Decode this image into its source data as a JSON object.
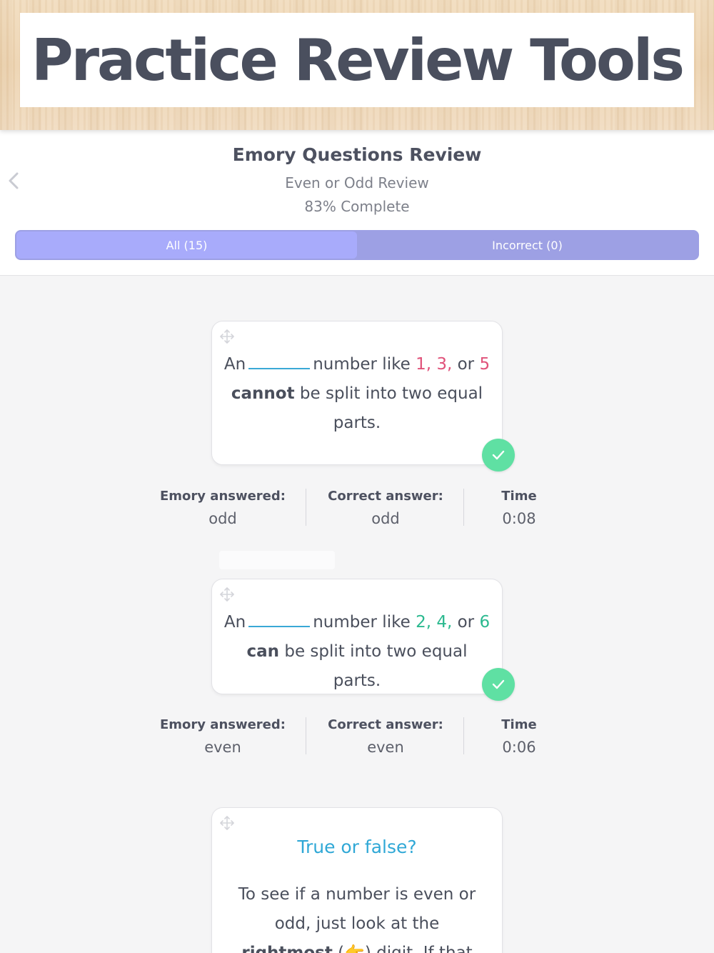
{
  "banner": {
    "title": "Practice Review Tools"
  },
  "header": {
    "title": "Emory Questions Review",
    "subtitle": "Even or Odd Review",
    "progress": "83% Complete",
    "tabs": [
      {
        "label": "All (15)",
        "active": true
      },
      {
        "label": "Incorrect (0)",
        "active": false
      }
    ]
  },
  "colors": {
    "accent": "#a8abfb",
    "tab_bar": "#9da0e4",
    "odd_numbers": "#e0527a",
    "even_numbers": "#2bb98f",
    "correct_check": "#5fe0a3",
    "blank_line": "#3aa8d6"
  },
  "questions": [
    {
      "prefix": "An",
      "middle": "number like",
      "numbers": [
        "1,",
        "3,",
        "5"
      ],
      "connector": "or",
      "emphasis": "cannot",
      "suffix": "be split into two equal parts.",
      "status": "check-icon",
      "answered_label": "Emory answered:",
      "answered": "odd",
      "correct_label": "Correct answer:",
      "correct": "odd",
      "time_label": "Time",
      "time": "0:08"
    },
    {
      "prefix": "An",
      "middle": "number like",
      "numbers": [
        "2,",
        "4,",
        "6"
      ],
      "connector": "or",
      "emphasis": "can",
      "suffix": "be split into two equal parts.",
      "status": "check-icon",
      "answered_label": "Emory answered:",
      "answered": "even",
      "correct_label": "Correct answer:",
      "correct": "even",
      "time_label": "Time",
      "time": "0:06"
    },
    {
      "heading": "True or false?",
      "line1": "To see if a number is even or",
      "line2": "odd, just look at the",
      "emphasis": "rightmost",
      "emoji": "👉",
      "line3_rest": "digit. If that"
    }
  ]
}
